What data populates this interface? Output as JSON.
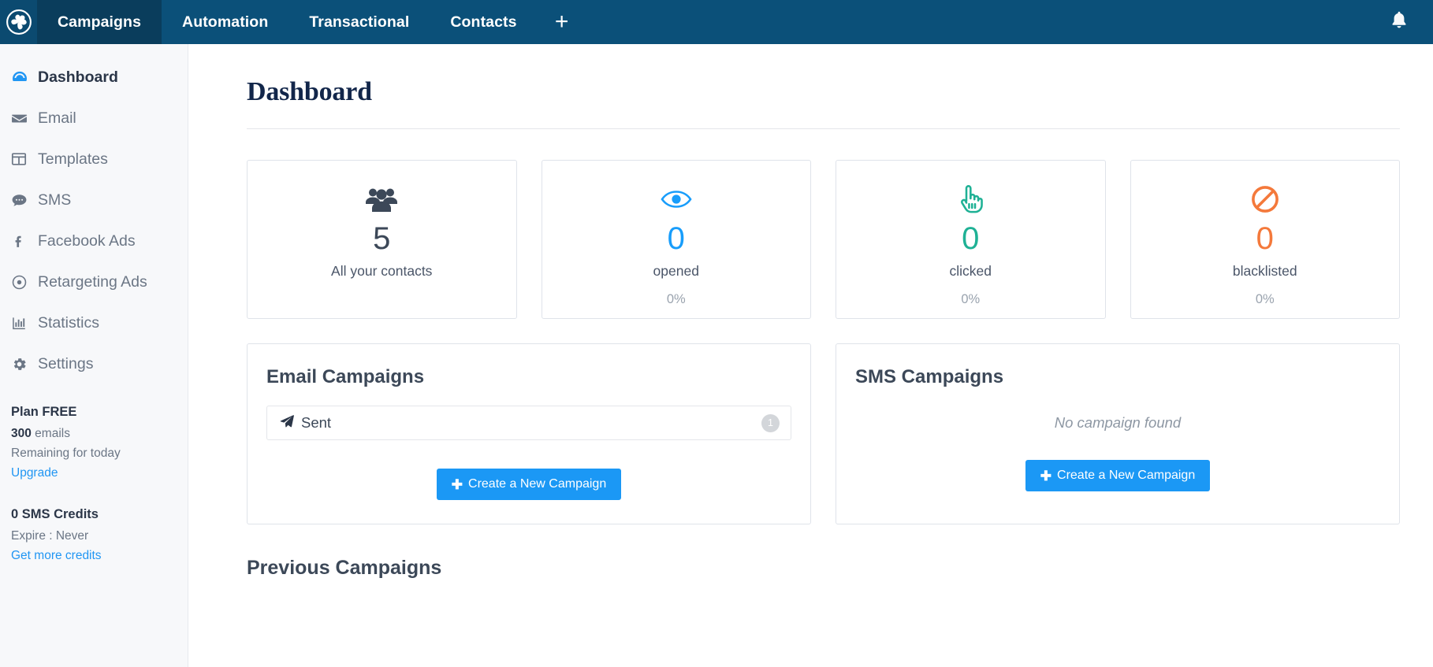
{
  "navbar": {
    "logo_icon": "pinwheel-logo-icon",
    "items": [
      {
        "label": "Campaigns",
        "active": true
      },
      {
        "label": "Automation",
        "active": false
      },
      {
        "label": "Transactional",
        "active": false
      },
      {
        "label": "Contacts",
        "active": false
      }
    ],
    "add_label": "+",
    "bell_icon": "bell-icon"
  },
  "sidebar": {
    "items": [
      {
        "label": "Dashboard",
        "icon": "speedometer-icon",
        "active": true
      },
      {
        "label": "Email",
        "icon": "envelope-icon",
        "active": false
      },
      {
        "label": "Templates",
        "icon": "layout-icon",
        "active": false
      },
      {
        "label": "SMS",
        "icon": "comment-icon",
        "active": false
      },
      {
        "label": "Facebook Ads",
        "icon": "facebook-icon",
        "active": false
      },
      {
        "label": "Retargeting Ads",
        "icon": "target-icon",
        "active": false
      },
      {
        "label": "Statistics",
        "icon": "bar-chart-icon",
        "active": false
      },
      {
        "label": "Settings",
        "icon": "gear-icon",
        "active": false
      }
    ],
    "plan": {
      "title": "Plan FREE",
      "amount": "300",
      "amount_unit": " emails",
      "note": "Remaining for today",
      "link": "Upgrade"
    },
    "credits": {
      "title": "0 SMS Credits",
      "note": "Expire : Never",
      "link": "Get more credits"
    }
  },
  "main": {
    "page_title": "Dashboard",
    "stats": [
      {
        "icon": "users-icon",
        "value": "5",
        "label": "All your contacts",
        "percent": "",
        "color": "#3c4858"
      },
      {
        "icon": "eye-icon",
        "value": "0",
        "label": "opened",
        "percent": "0%",
        "color": "#189dfb"
      },
      {
        "icon": "hand-pointer-icon",
        "value": "0",
        "label": "clicked",
        "percent": "0%",
        "color": "#1fb195"
      },
      {
        "icon": "ban-icon",
        "value": "0",
        "label": "blacklisted",
        "percent": "0%",
        "color": "#f4793b"
      }
    ],
    "email_panel": {
      "title": "Email Campaigns",
      "row_label": "Sent",
      "row_icon": "paper-plane-icon",
      "row_count": "1",
      "button_label": "Create a New Campaign"
    },
    "sms_panel": {
      "title": "SMS Campaigns",
      "empty_text": "No campaign found",
      "button_label": "Create a New Campaign"
    },
    "previous_campaigns_title": "Previous Campaigns"
  }
}
